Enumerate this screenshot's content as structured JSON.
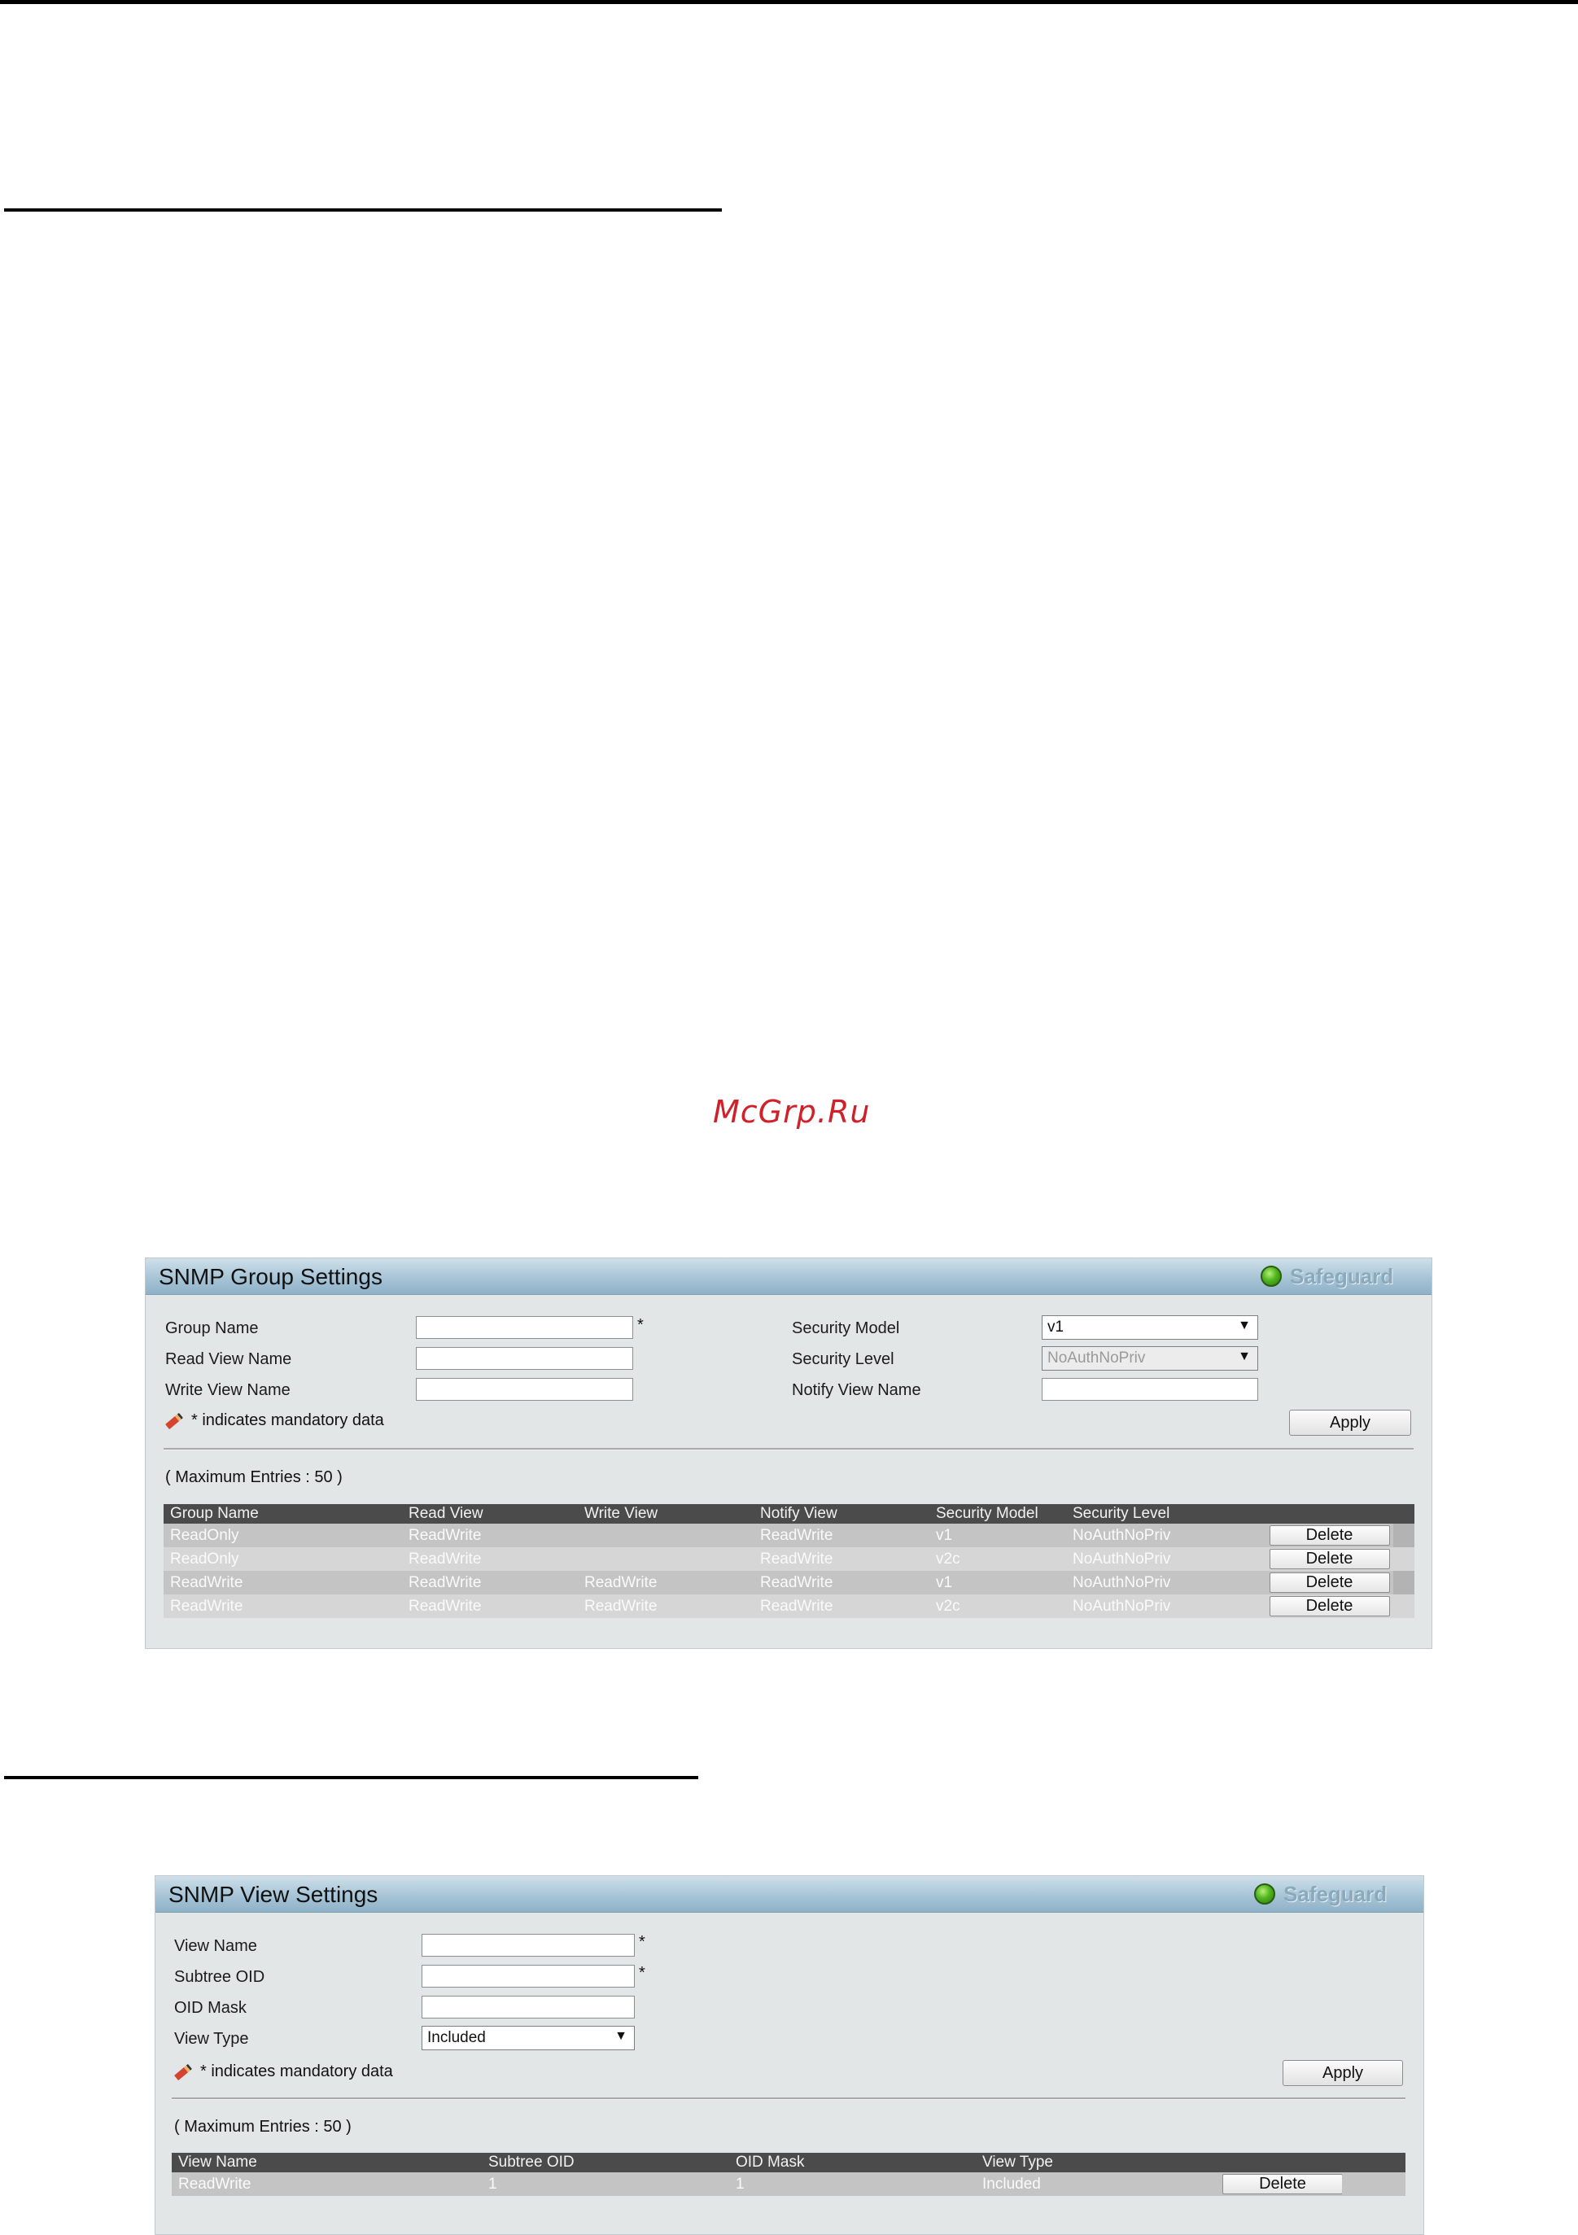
{
  "watermark": "McGrp.Ru",
  "group_panel": {
    "title": "SNMP Group Settings",
    "safeguard": "Safeguard",
    "form": {
      "group_name_label": "Group Name",
      "read_view_label": "Read View Name",
      "write_view_label": "Write View Name",
      "security_model_label": "Security Model",
      "security_level_label": "Security Level",
      "notify_view_label": "Notify View Name",
      "security_model_value": "v1",
      "security_level_value": "NoAuthNoPriv",
      "asterisk": "*"
    },
    "mandatory_note": "* indicates mandatory data",
    "apply": "Apply",
    "max_entries": "( Maximum Entries : 50 )",
    "columns": [
      "Group Name",
      "Read View",
      "Write View",
      "Notify View",
      "Security Model",
      "Security Level"
    ],
    "delete_label": "Delete",
    "rows": [
      {
        "group": "ReadOnly",
        "read": "ReadWrite",
        "write": "",
        "notify": "ReadWrite",
        "model": "v1",
        "level": "NoAuthNoPriv"
      },
      {
        "group": "ReadOnly",
        "read": "ReadWrite",
        "write": "",
        "notify": "ReadWrite",
        "model": "v2c",
        "level": "NoAuthNoPriv"
      },
      {
        "group": "ReadWrite",
        "read": "ReadWrite",
        "write": "ReadWrite",
        "notify": "ReadWrite",
        "model": "v1",
        "level": "NoAuthNoPriv"
      },
      {
        "group": "ReadWrite",
        "read": "ReadWrite",
        "write": "ReadWrite",
        "notify": "ReadWrite",
        "model": "v2c",
        "level": "NoAuthNoPriv"
      }
    ]
  },
  "view_panel": {
    "title": "SNMP View Settings",
    "safeguard": "Safeguard",
    "form": {
      "view_name_label": "View Name",
      "subtree_oid_label": "Subtree OID",
      "oid_mask_label": "OID Mask",
      "view_type_label": "View Type",
      "view_type_value": "Included",
      "asterisk": "*"
    },
    "mandatory_note": "* indicates mandatory data",
    "apply": "Apply",
    "max_entries": "( Maximum Entries : 50 )",
    "columns": [
      "View Name",
      "Subtree OID",
      "OID Mask",
      "View Type"
    ],
    "delete_label": "Delete",
    "rows": [
      {
        "name": "ReadWrite",
        "subtree": "1",
        "mask": "1",
        "type": "Included"
      }
    ]
  },
  "colors": {
    "header_gradient_top": "#cfe0ea",
    "header_gradient_bottom": "#8fb2c8",
    "panel_bg": "#e3e6e7",
    "table_header_bg": "#4b4b4b",
    "watermark": "#d0212b"
  }
}
